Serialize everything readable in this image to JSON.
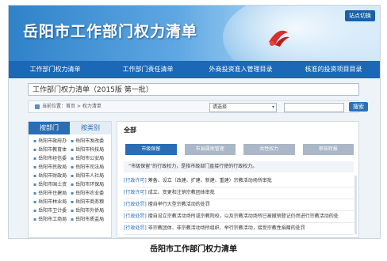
{
  "banner": {
    "title": "岳阳市工作部门权力清单",
    "switch_label": "站点切换"
  },
  "nav": {
    "items": [
      "工作部门权力清单",
      "工作部门责任清单",
      "外商投资准入管理目录",
      "核准的投资项目目录"
    ]
  },
  "page_title": "工作部门权力清单（2015版 第一批）",
  "breadcrumb": "当前位置：首页 > 权力清单",
  "search": {
    "select_value": "请选择",
    "button_label": "搜索"
  },
  "left_panel": {
    "tabs": [
      "按部门",
      "按类别"
    ],
    "departments": [
      "岳阳市政府办",
      "岳阳市发改委",
      "岳阳市教育体",
      "岳阳市科技局",
      "岳阳市经信委",
      "岳阳市公安局",
      "岳阳市民政局",
      "岳阳市司法局",
      "岳阳市财政局",
      "岳阳市人社局",
      "岳阳市国土资",
      "岳阳市环保局",
      "岳阳市住建局",
      "岳阳市农业委",
      "岳阳市林业局",
      "岳阳市商务粮",
      "岳阳市卫计委",
      "岳阳市外侨局",
      "岳阳市工商局",
      "岳阳市质监局"
    ]
  },
  "right_panel": {
    "heading": "全部",
    "categories": [
      "市级保留",
      "市县属地管理",
      "共性权力",
      "审核转报"
    ],
    "description": "“市级保留”的行政权力，是指市级部门直接行使的行政权力。",
    "items": [
      {
        "tag": "[行政许可]",
        "text": "筹备、设立（改建、扩建、新建、重建）宗教活动场所审批"
      },
      {
        "tag": "[行政许可]",
        "text": "成立、变更和注销宗教团体审批"
      },
      {
        "tag": "[行政处罚]",
        "text": "擅自举行大型宗教活动的处罚"
      },
      {
        "tag": "[行政处罚]",
        "text": "擅自设立宗教活动场所或宗教院校，以及宗教活动场所已被撤销登记仍然进行宗教活动的处"
      },
      {
        "tag": "[行政处罚]",
        "text": "非宗教团体、非宗教活动场所组织、举行宗教活动，接受宗教性捐赠的处罚"
      }
    ]
  },
  "caption": "岳阳市工作部门权力清单"
}
